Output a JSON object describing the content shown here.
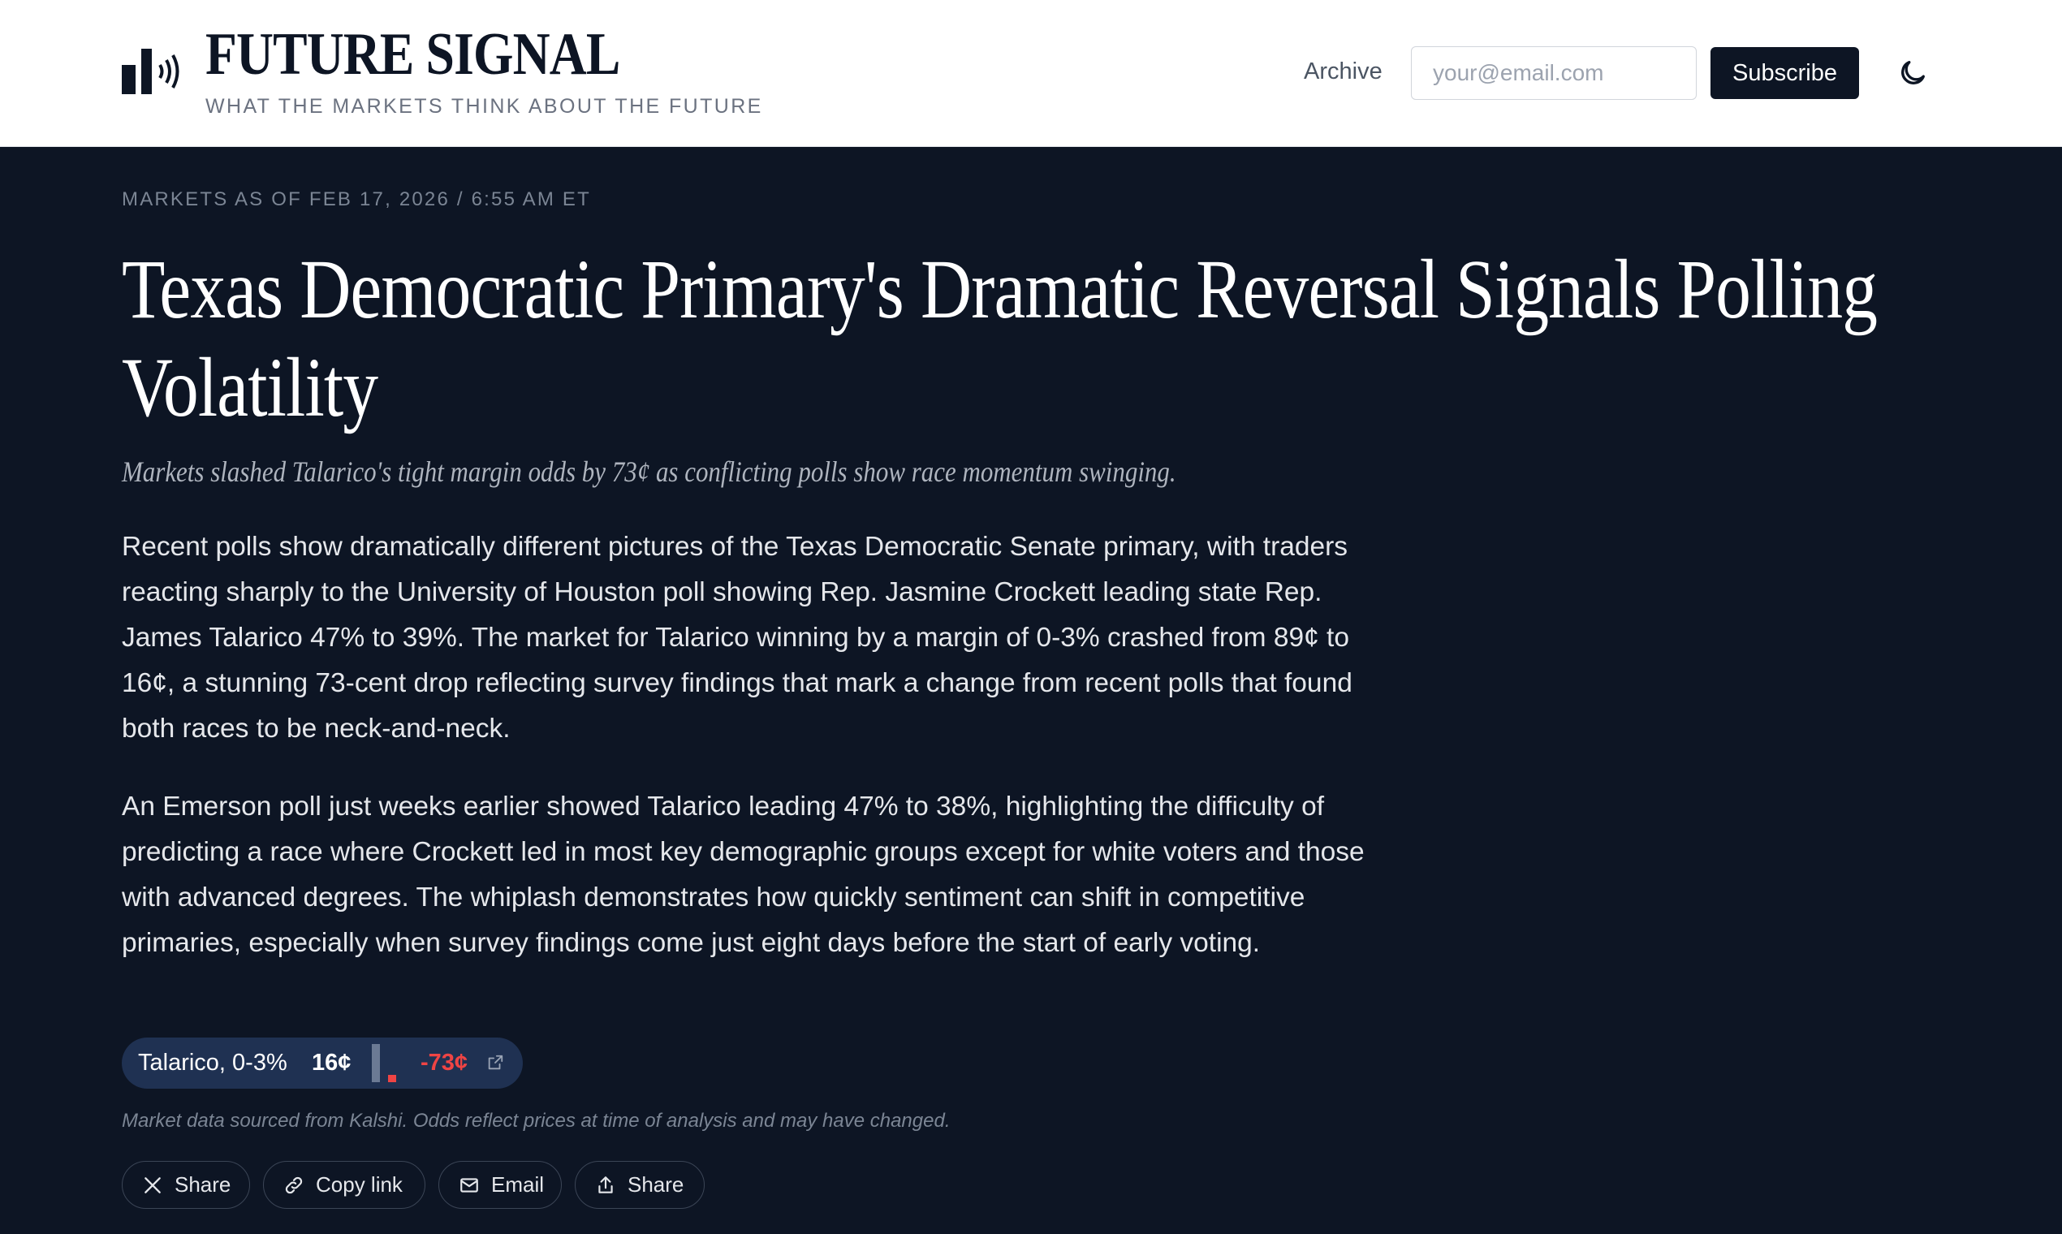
{
  "header": {
    "brand": "FUTURE SIGNAL",
    "tagline": "WHAT THE MARKETS THINK ABOUT THE FUTURE",
    "nav_archive": "Archive",
    "email_placeholder": "your@email.com",
    "subscribe_label": "Subscribe",
    "theme_icon": "moon-icon"
  },
  "article": {
    "meta": "MARKETS AS OF FEB 17, 2026 / 6:55 AM ET",
    "headline_lines": [
      "Texas Democratic Primary's Dramatic Reversal Signals Polling",
      "Volatility"
    ],
    "subhead": "Markets slashed Talarico's tight margin odds by 73¢ as conflicting polls show race momentum swinging.",
    "paragraphs": [
      "Recent polls show dramatically different pictures of the Texas Democratic Senate primary, with traders reacting sharply to the University of Houston poll showing Rep. Jasmine Crockett leading state Rep. James Talarico 47% to 39%. The market for Talarico winning by a margin of 0-3% crashed from 89¢ to 16¢, a stunning 73-cent drop reflecting survey findings that mark a change from recent polls that found both races to be neck-and-neck.",
      "An Emerson poll just weeks earlier showed Talarico leading 47% to 38%, highlighting the difficulty of predicting a race where Crockett led in most key demographic groups except for white voters and those with advanced degrees. The whiplash demonstrates how quickly sentiment can shift in competitive primaries, especially when survey findings come just eight days before the start of early voting."
    ]
  },
  "market": {
    "name": "Talarico, 0-3%",
    "price": "16¢",
    "change": "-73¢",
    "previous_price_cents": 89,
    "current_price_cents": 16,
    "down_color": "#ef4444",
    "link_icon": "external-link-icon"
  },
  "disclaimer": "Market data sourced from Kalshi. Odds reflect prices at time of analysis and may have changed.",
  "share_buttons": [
    {
      "label": "Share",
      "icon": "x-logo-icon"
    },
    {
      "label": "Copy link",
      "icon": "link-icon"
    },
    {
      "label": "Email",
      "icon": "mail-icon"
    },
    {
      "label": "Share",
      "icon": "share-icon"
    }
  ],
  "colors": {
    "background": "#0d1524",
    "header_bg": "#ffffff",
    "pill_bg": "#1f3152"
  }
}
